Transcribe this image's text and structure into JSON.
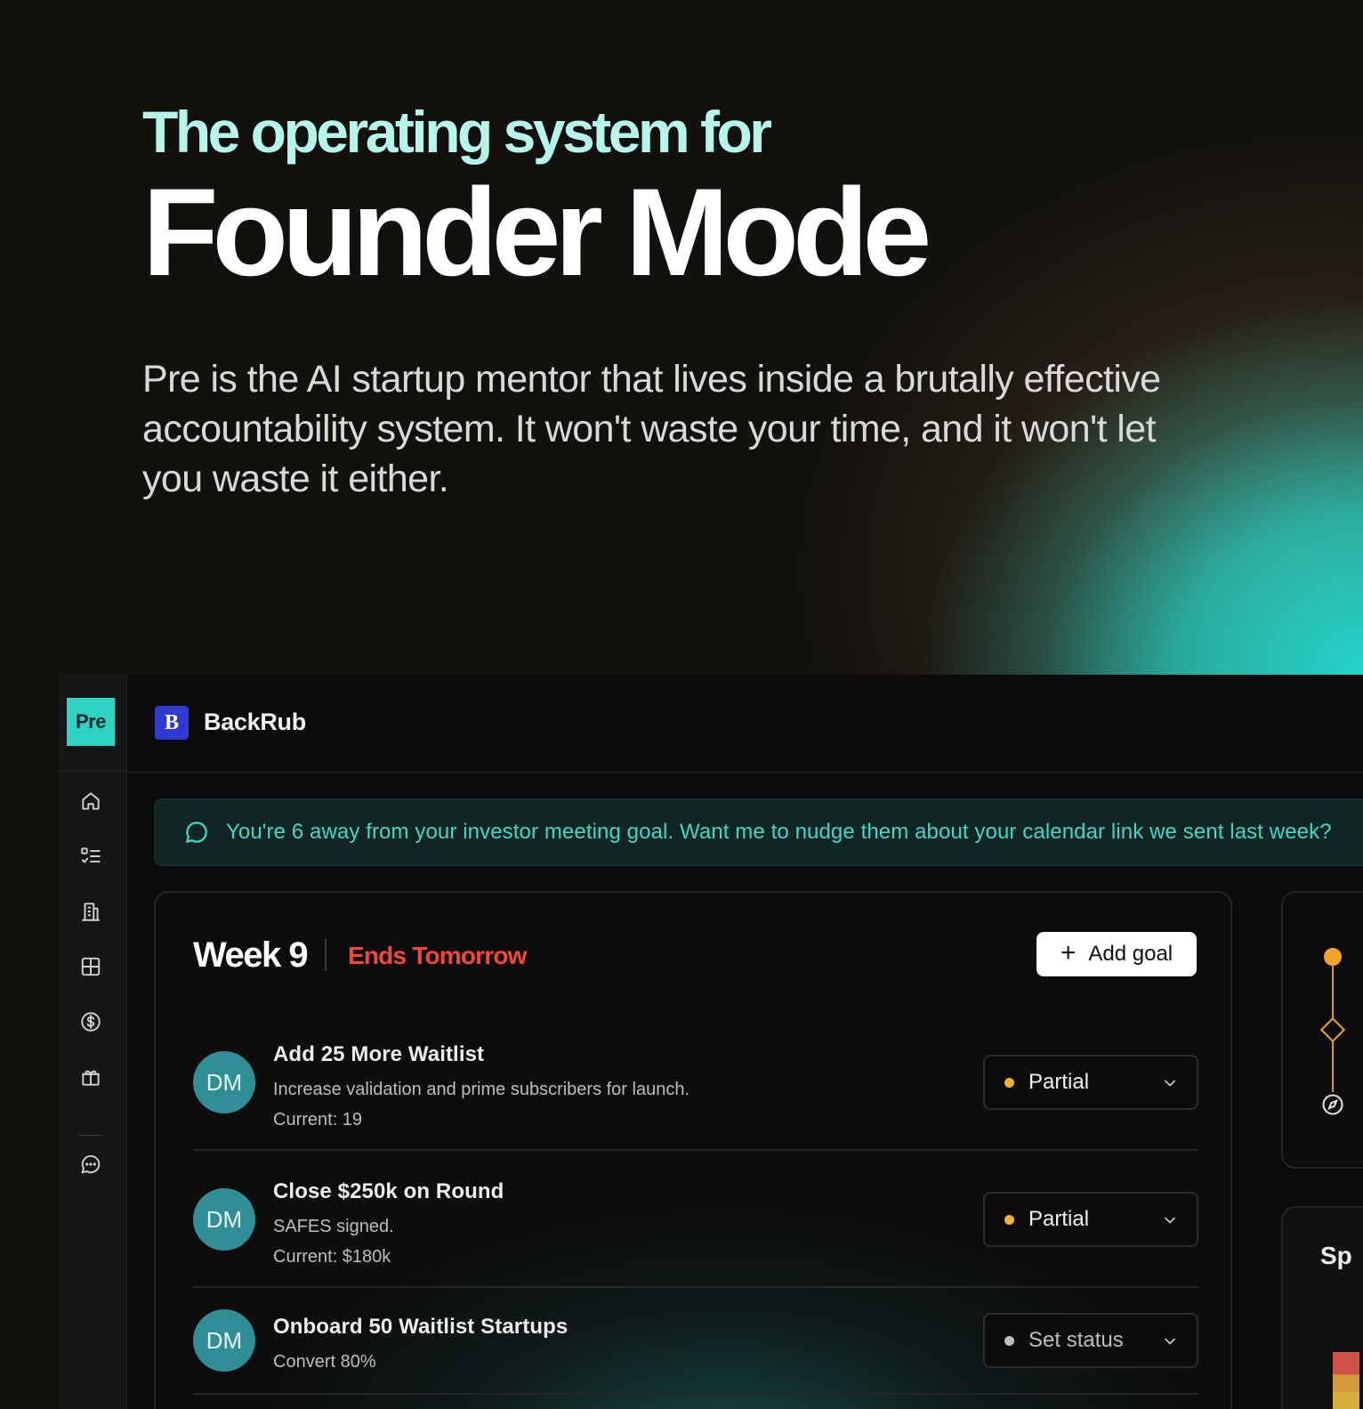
{
  "hero": {
    "kicker": "The operating system for",
    "headline": "Founder Mode",
    "lede": "Pre is the AI startup mentor that lives inside a brutally effective accountability system. It won't waste your time, and it won't let you waste it either."
  },
  "app": {
    "logo_label": "Pre",
    "sidebar": [
      {
        "name": "home",
        "icon": "home-icon"
      },
      {
        "name": "tasks",
        "icon": "checklist-icon"
      },
      {
        "name": "company",
        "icon": "building-icon"
      },
      {
        "name": "grid",
        "icon": "grid-icon"
      },
      {
        "name": "funding",
        "icon": "dollar-icon"
      },
      {
        "name": "gifts",
        "icon": "gift-icon"
      },
      {
        "name": "chat",
        "icon": "chat-icon"
      }
    ],
    "company": {
      "logo_letter": "B",
      "name": "BackRub"
    },
    "banner": {
      "text": "You're 6 away from your investor meeting goal. Want me to nudge them about your calendar link we sent last week?"
    },
    "week": {
      "title": "Week 9",
      "due": "Ends Tomorrow",
      "add_goal_label": "Add goal"
    },
    "goals": [
      {
        "avatar": "DM",
        "title": "Add 25 More Waitlist",
        "description": "Increase validation and prime subscribers for launch.",
        "current": "Current: 19",
        "status": "Partial",
        "status_color": "#f2b32b"
      },
      {
        "avatar": "DM",
        "title": "Close $250k on Round",
        "description": "SAFES signed.",
        "current": "Current: $180k",
        "status": "Partial",
        "status_color": "#f2b32b"
      },
      {
        "avatar": "DM",
        "title": "Onboard 50 Waitlist Startups",
        "description": "Convert 80%",
        "current": "",
        "status": "Set status",
        "status_color": "#bdbdbd"
      }
    ],
    "side_panel": {
      "title": "Sp"
    },
    "colors": {
      "accent": "#2fd3c4",
      "warning": "#f2a52b",
      "danger": "#f0483e"
    }
  }
}
